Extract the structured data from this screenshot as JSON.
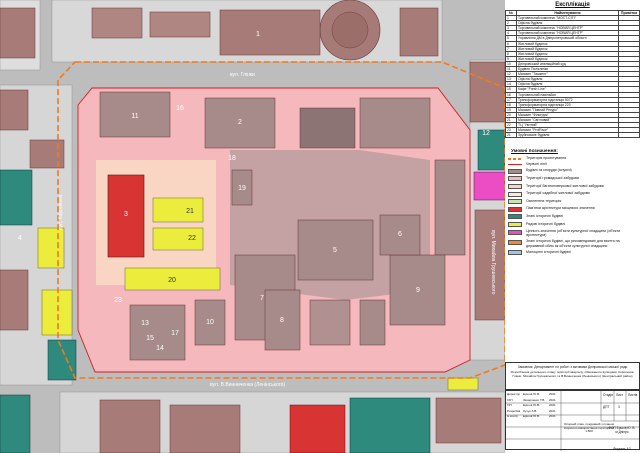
{
  "legend_table": {
    "title": "Експлікація",
    "col_num": "№",
    "col_name": "Найменування",
    "col_note": "Примітка",
    "rows": [
      {
        "n": "1",
        "name": "Торговельний комплекс \"МОСТ-СІТІ\""
      },
      {
        "n": "2",
        "name": "Офісна будівля"
      },
      {
        "n": "3",
        "name": "Торговельний комплекс \"НОВИЙ ЦЕНТР\""
      },
      {
        "n": "4",
        "name": "Торговельний комплекс \"НОВИЙ ЦЕНТР\""
      },
      {
        "n": "5",
        "name": "Управління ДМ в Дніпропетровській області"
      },
      {
        "n": "6",
        "name": "Житловий будинок"
      },
      {
        "n": "7",
        "name": "Житловий будинок"
      },
      {
        "n": "8",
        "name": "Житловий будинок"
      },
      {
        "n": "9",
        "name": "Житловий будинок"
      },
      {
        "n": "10",
        "name": "Дніпровський апеляційний суд"
      },
      {
        "n": "11",
        "name": "Будівля Поліклініки"
      },
      {
        "n": "12",
        "name": "Магазин \"Ташкент\""
      },
      {
        "n": "13",
        "name": "Офісна будівля"
      },
      {
        "n": "14",
        "name": "Офісна будівля"
      },
      {
        "n": "15",
        "name": "Кафе \"Fresh Line\""
      },
      {
        "n": "16",
        "name": "Торговельний павільйон"
      },
      {
        "n": "17",
        "name": "Трансформаторна підстанція 5072"
      },
      {
        "n": "18",
        "name": "Трансформаторна підстанція 220"
      },
      {
        "n": "19",
        "name": "Магазин \"Пивний Ресурс\""
      },
      {
        "n": "20",
        "name": "Магазин \"Фільтрум\""
      },
      {
        "n": "21",
        "name": "Магазин \"Світловий\""
      },
      {
        "n": "22",
        "name": "ТЦ \"Уютний\""
      },
      {
        "n": "23",
        "name": "Магазин \"ProfFace\""
      },
      {
        "n": "21",
        "name": "Зруйноване будівля"
      }
    ]
  },
  "legend": {
    "title": "Умовні позначення:",
    "items": [
      {
        "label": "Територія проектування",
        "color": "#f07a1e",
        "kind": "dash"
      },
      {
        "label": "Червоні лінії",
        "color": "#e02020",
        "kind": "line"
      },
      {
        "label": "Будівлі та споруди (існуючі)",
        "color": "#a78a8a",
        "kind": "fill"
      },
      {
        "label": "Території громадської забудови",
        "color": "#f5b9bd",
        "kind": "fill"
      },
      {
        "label": "Території багатоповерхової житлової забудови",
        "color": "#f8d6c3",
        "kind": "fill"
      },
      {
        "label": "Території садибної житлової забудови",
        "color": "#fbe7d5",
        "kind": "fill"
      },
      {
        "label": "Озеленена територія",
        "color": "#c9e6b0",
        "kind": "fill"
      },
      {
        "label": "Пам'ятки архітектури місцевого значення",
        "color": "#d83434",
        "kind": "fill"
      },
      {
        "label": "Знані історичні будівлі",
        "color": "#2e8a7d",
        "kind": "fill"
      },
      {
        "label": "Рядові історичні будівлі",
        "color": "#ecec3c",
        "kind": "fill"
      },
      {
        "label": "Цінність значення (об'єкти культурної спадщини (об'єкти архітектури)",
        "color": "#ec4cc4",
        "kind": "fill"
      },
      {
        "label": "Знані історичні будівлі, що рекомендовані для взяття на державний облік як об'єкти культурної спадщини",
        "color": "#f08a2c",
        "kind": "fill"
      },
      {
        "label": "Малоцінні історичні будівлі",
        "color": "#9ec6e6",
        "kind": "fill"
      }
    ]
  },
  "stamp": {
    "customer": "Замовник: Департамент по роботі з активами Дніпровської міської ради",
    "project": "Розроблення детального плану території кварталу, обмеженого вулицями: Короленка, Глінки, Михайла Грушевського та В.Винниченка (Ленінського) (Центральний район)",
    "sheet_header_stage": "Стадія",
    "sheet_header_sheet": "Лист",
    "sheet_header_sheets": "Листів",
    "stage": "ДПТ",
    "sheet": "3",
    "drawing": "Опорний план, поєднаний з планом існуючого використання території М 1:500",
    "org": "ФОП Ершов Ю. В. м.Дніпро",
    "format": "Формат А2",
    "rows": [
      {
        "role": "Директор",
        "name": "Ершов Ю.В.",
        "date": "2021"
      },
      {
        "role": "ГАП",
        "name": "Захарченко Т.В.",
        "date": "2021"
      },
      {
        "role": "ГІП",
        "name": "Ершов Ю.В.",
        "date": "2021"
      },
      {
        "role": "Розробив",
        "name": "Кучук А.В.",
        "date": "2021"
      },
      {
        "role": "Н.контр.",
        "name": "Ершов Ю.В.",
        "date": "2021"
      }
    ]
  },
  "map": {
    "street_labels": [
      "вул. Глінки",
      "вул. В.Винниченка (Ленінського)",
      "вул. Короленка",
      "вул. Михайла Грушевського"
    ],
    "numbers": [
      "1",
      "2",
      "3",
      "4",
      "5",
      "6",
      "7",
      "8",
      "9",
      "10",
      "11",
      "12",
      "13",
      "14",
      "15",
      "16",
      "17",
      "18",
      "19",
      "20",
      "21",
      "22",
      "23"
    ],
    "colors": {
      "road": "#c8c8c8",
      "public": "#f5b9bd",
      "residential": "#f8d6c3",
      "building": "#a78a8a",
      "monument": "#d83434",
      "teal": "#2e8a7d",
      "yellow": "#ecec3c",
      "magenta": "#ec4cc4",
      "boundary": "#f07a1e"
    }
  }
}
